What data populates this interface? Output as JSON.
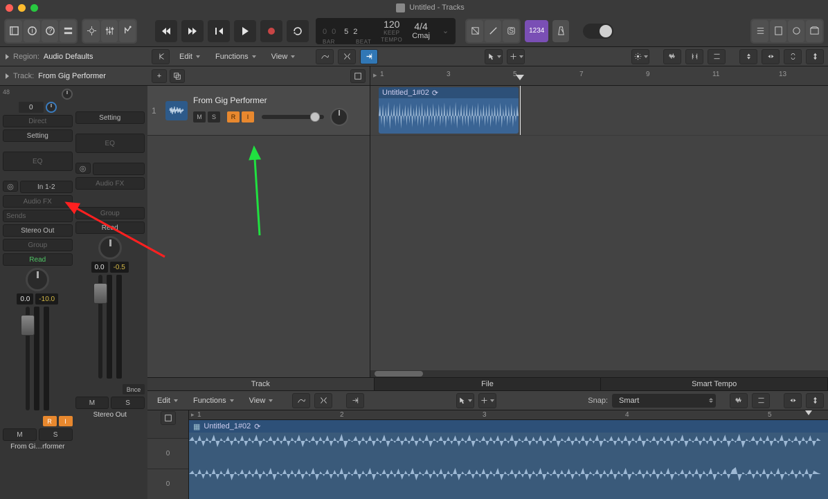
{
  "window": {
    "title": "Untitled - Tracks"
  },
  "lcd": {
    "bars_dim": "0 0",
    "bars_main": "5 2",
    "bar_label": "BAR",
    "beat_label": "BEAT",
    "tempo_val": "120",
    "tempo_sub": "KEEP",
    "tempo_label": "TEMPO",
    "sig_val": "4/4",
    "key_val": "Cmaj"
  },
  "toolbar": {
    "number_btn": "1234"
  },
  "region_bar": {
    "label": "Region:",
    "value": "Audio Defaults"
  },
  "track_bar": {
    "label": "Track:",
    "value": "From Gig Performer"
  },
  "channel1": {
    "top_num": "48",
    "zero": "0",
    "direct": "Direct",
    "setting": "Setting",
    "eq": "EQ",
    "input": "In 1-2",
    "audiofx": "Audio FX",
    "sends": "Sends",
    "out": "Stereo Out",
    "group": "Group",
    "read": "Read",
    "db1": "0.0",
    "db2": "-10.0",
    "rec": "R",
    "mon": "I",
    "mute": "M",
    "solo": "S",
    "name": "From Gi…rformer"
  },
  "channel2": {
    "setting": "Setting",
    "eq": "EQ",
    "audiofx": "Audio FX",
    "out": "",
    "group": "Group",
    "read": "Read",
    "db1": "0.0",
    "db2": "-0.5",
    "bnce": "Bnce",
    "mute": "M",
    "solo": "S",
    "name": "Stereo Out"
  },
  "arrange_menu": {
    "edit": "Edit",
    "functions": "Functions",
    "view": "View"
  },
  "track": {
    "num": "1",
    "name": "From Gig Performer",
    "mute": "M",
    "solo": "S",
    "rec": "R",
    "mon": "I"
  },
  "region": {
    "name": "Untitled_1#02"
  },
  "ruler": [
    "1",
    "3",
    "5",
    "7",
    "9",
    "11",
    "13"
  ],
  "editor_tabs": {
    "track": "Track",
    "file": "File",
    "smart": "Smart Tempo"
  },
  "editor_toolbar": {
    "edit": "Edit",
    "functions": "Functions",
    "view": "View",
    "snap_label": "Snap:",
    "snap_value": "Smart"
  },
  "editor_ruler": [
    "1",
    "2",
    "3",
    "4",
    "5"
  ],
  "editor_region_name": "Untitled_1#02",
  "editor_channels": [
    "0",
    "0"
  ]
}
